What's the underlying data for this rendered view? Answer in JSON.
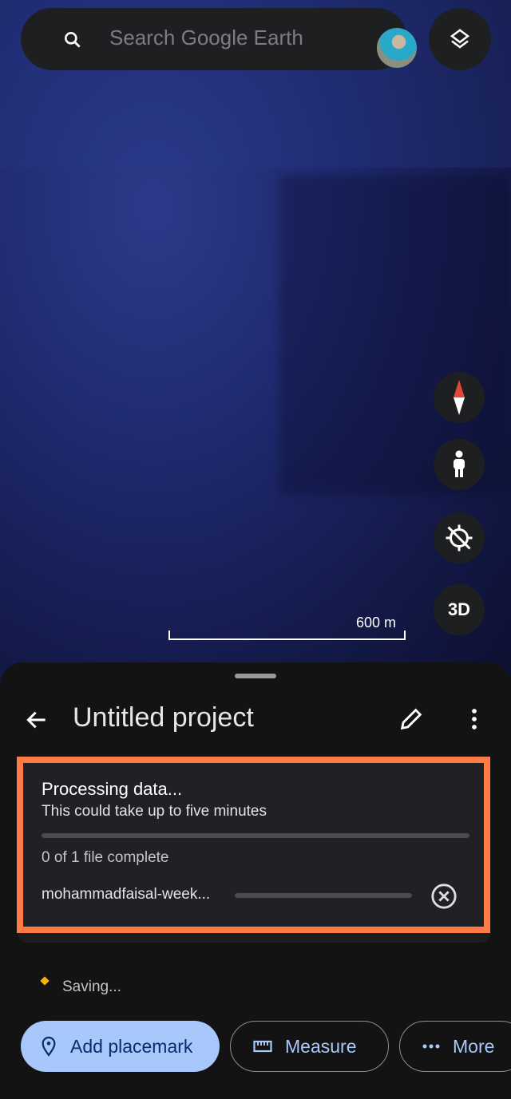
{
  "search": {
    "placeholder": "Search Google Earth"
  },
  "map": {
    "scale_label": "600 m",
    "three_d_label": "3D"
  },
  "project": {
    "title": "Untitled project"
  },
  "processing": {
    "title": "Processing data...",
    "subtitle": "This could take up to five minutes",
    "overall_progress": 0,
    "count_text": "0 of 1 file complete",
    "file_name": "mohammadfaisal-week...",
    "file_progress": 0,
    "highlight_color": "#ff7b45"
  },
  "status": {
    "saving_text": "Saving..."
  },
  "actions": {
    "add_placemark": "Add placemark",
    "measure": "Measure",
    "more": "More"
  }
}
